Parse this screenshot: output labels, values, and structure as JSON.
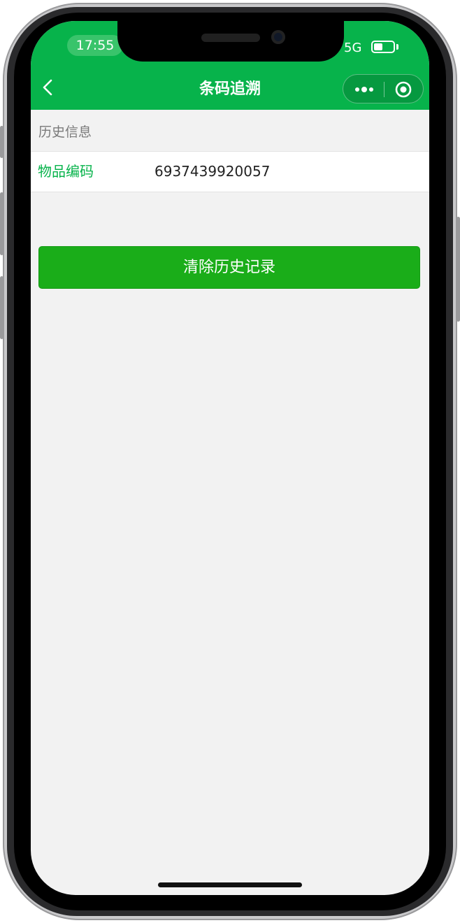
{
  "status_bar": {
    "time": "17:55",
    "network": "5G"
  },
  "nav": {
    "title": "条码追溯",
    "back_icon": "chevron-left-icon",
    "more_icon": "more-dots-icon",
    "close_icon": "target-circle-icon"
  },
  "history": {
    "section_label": "历史信息",
    "items": [
      {
        "label": "物品编码",
        "value": "6937439920057"
      }
    ]
  },
  "actions": {
    "clear_label": "清除历史记录"
  },
  "colors": {
    "brand_green": "#07b34b",
    "button_green": "#1aad19",
    "page_bg": "#f2f2f2"
  }
}
